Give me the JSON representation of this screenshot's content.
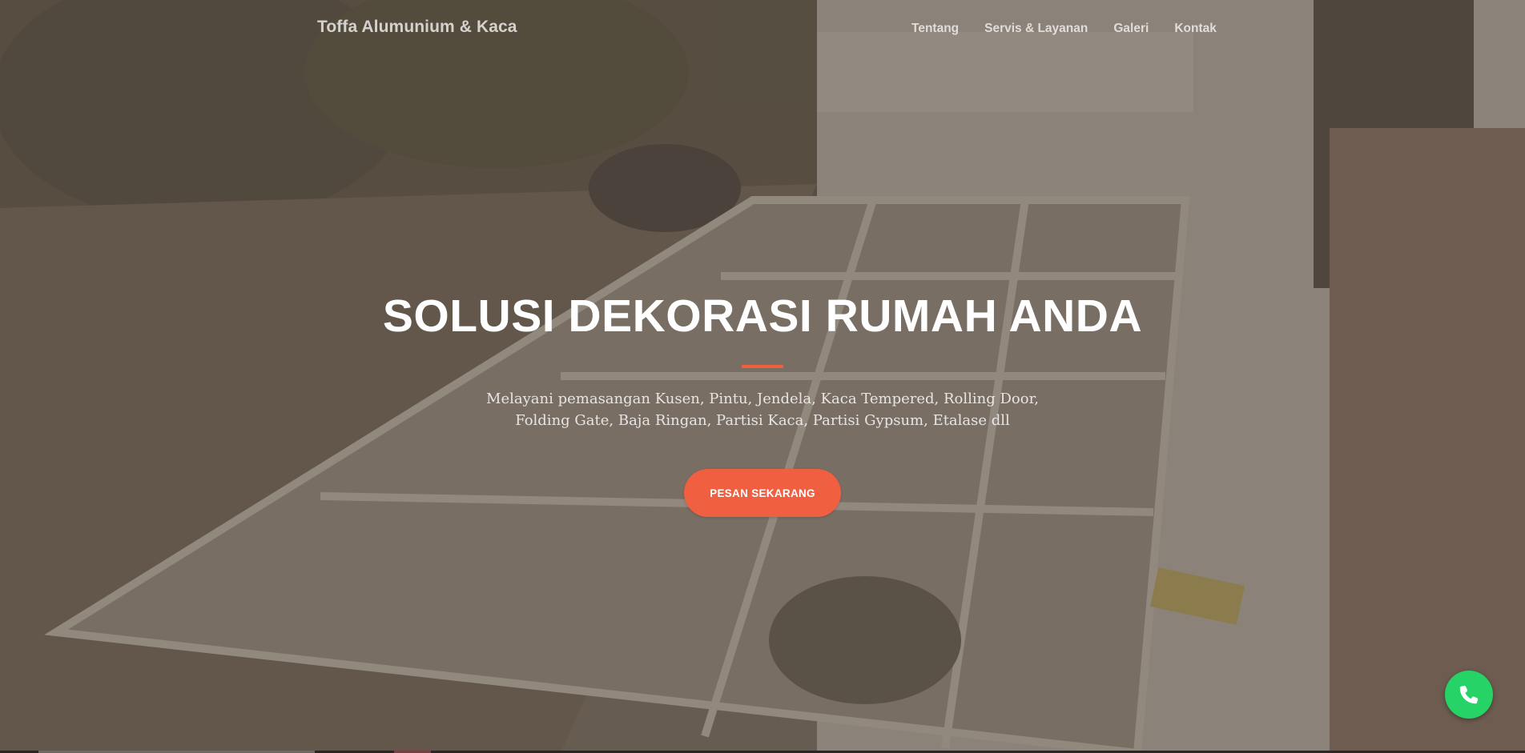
{
  "brand": {
    "name": "Toffa Alumunium & Kaca"
  },
  "nav": {
    "items": [
      {
        "label": "Tentang"
      },
      {
        "label": "Servis & Layanan"
      },
      {
        "label": "Galeri"
      },
      {
        "label": "Kontak"
      }
    ]
  },
  "hero": {
    "headline": "SOLUSI DEKORASI RUMAH ANDA",
    "subtitle_line1": "Melayani pemasangan Kusen, Pintu, Jendela, Kaca Tempered, Rolling Door,",
    "subtitle_line2": "Folding Gate, Baja Ringan, Partisi Kaca, Partisi Gypsum, Etalase dll",
    "cta_label": "PESAN SEKARANG",
    "background_image": "glass canopy roof over a house terrace"
  },
  "floating": {
    "whatsapp_icon": "phone-icon"
  },
  "colors": {
    "accent": "#f05f40",
    "whatsapp": "#25d366",
    "overlay": "#5c5046"
  }
}
